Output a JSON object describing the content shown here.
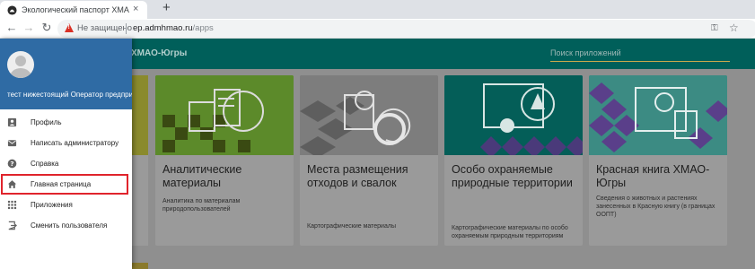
{
  "browser": {
    "tab_title": "Экологический паспорт ХМАО-",
    "tab_close": "×",
    "new_tab": "+",
    "back": "←",
    "forward": "→",
    "reload": "↻",
    "not_secure": "Не защищено",
    "url_host": "ep.admhmao.ru",
    "url_path": "/apps",
    "key_icon": "⚿",
    "star_icon": "☆"
  },
  "appbar": {
    "title": "ХМАО-Югры",
    "search_placeholder": "Поиск приложений"
  },
  "drawer": {
    "user_name": "тест нижестоящий Оператор предприятия",
    "items": [
      {
        "label": "Профиль",
        "icon": "account-box-icon"
      },
      {
        "label": "Написать администратору",
        "icon": "mail-icon"
      },
      {
        "label": "Справка",
        "icon": "help-icon"
      },
      {
        "label": "Главная страница",
        "icon": "home-icon"
      },
      {
        "label": "Приложения",
        "icon": "apps-icon"
      },
      {
        "label": "Сменить пользователя",
        "icon": "exit-icon"
      }
    ]
  },
  "cards": [
    {
      "title": "Аналитические материалы",
      "desc": "Аналитика по материалам природопользователей"
    },
    {
      "title": "Места размещения отходов и свалок",
      "desc": "Картографические материалы"
    },
    {
      "title": "Особо охраняемые природные территории",
      "desc": "Картографические материалы по особо охраняемым природным территориям"
    },
    {
      "title": "Красная книга ХМАО-Югры",
      "desc": "Сведения о животных и растениях занесенных в Красную книгу (в границах ООПТ)"
    }
  ],
  "colors": {
    "appbar": "#005f5a",
    "drawer_header": "#2f6ba4",
    "active_outline": "#e0242c",
    "card1": "#5c8a2a",
    "card2": "#7d7d7d",
    "card3": "#045e58",
    "card4": "#3c8b83"
  }
}
